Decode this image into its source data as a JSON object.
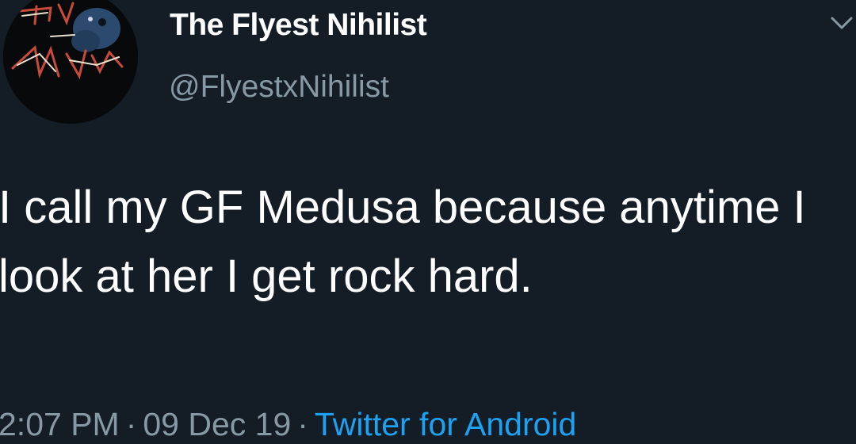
{
  "tweet": {
    "author": {
      "display_name": "The Flyest Nihilist",
      "handle": "@FlyestxNihilist",
      "avatar_icon": "band-logo-avatar"
    },
    "menu_icon": "chevron-down-icon",
    "text": "I call my GF Medusa because anytime I look at her I get rock hard.",
    "time": "2:07 PM",
    "separator": "·",
    "date": "09 Dec 19",
    "source": "Twitter for Android"
  },
  "colors": {
    "background": "#141d26",
    "primary_text": "#ffffff",
    "secondary_text": "#8899a6",
    "link": "#1da1f2"
  }
}
